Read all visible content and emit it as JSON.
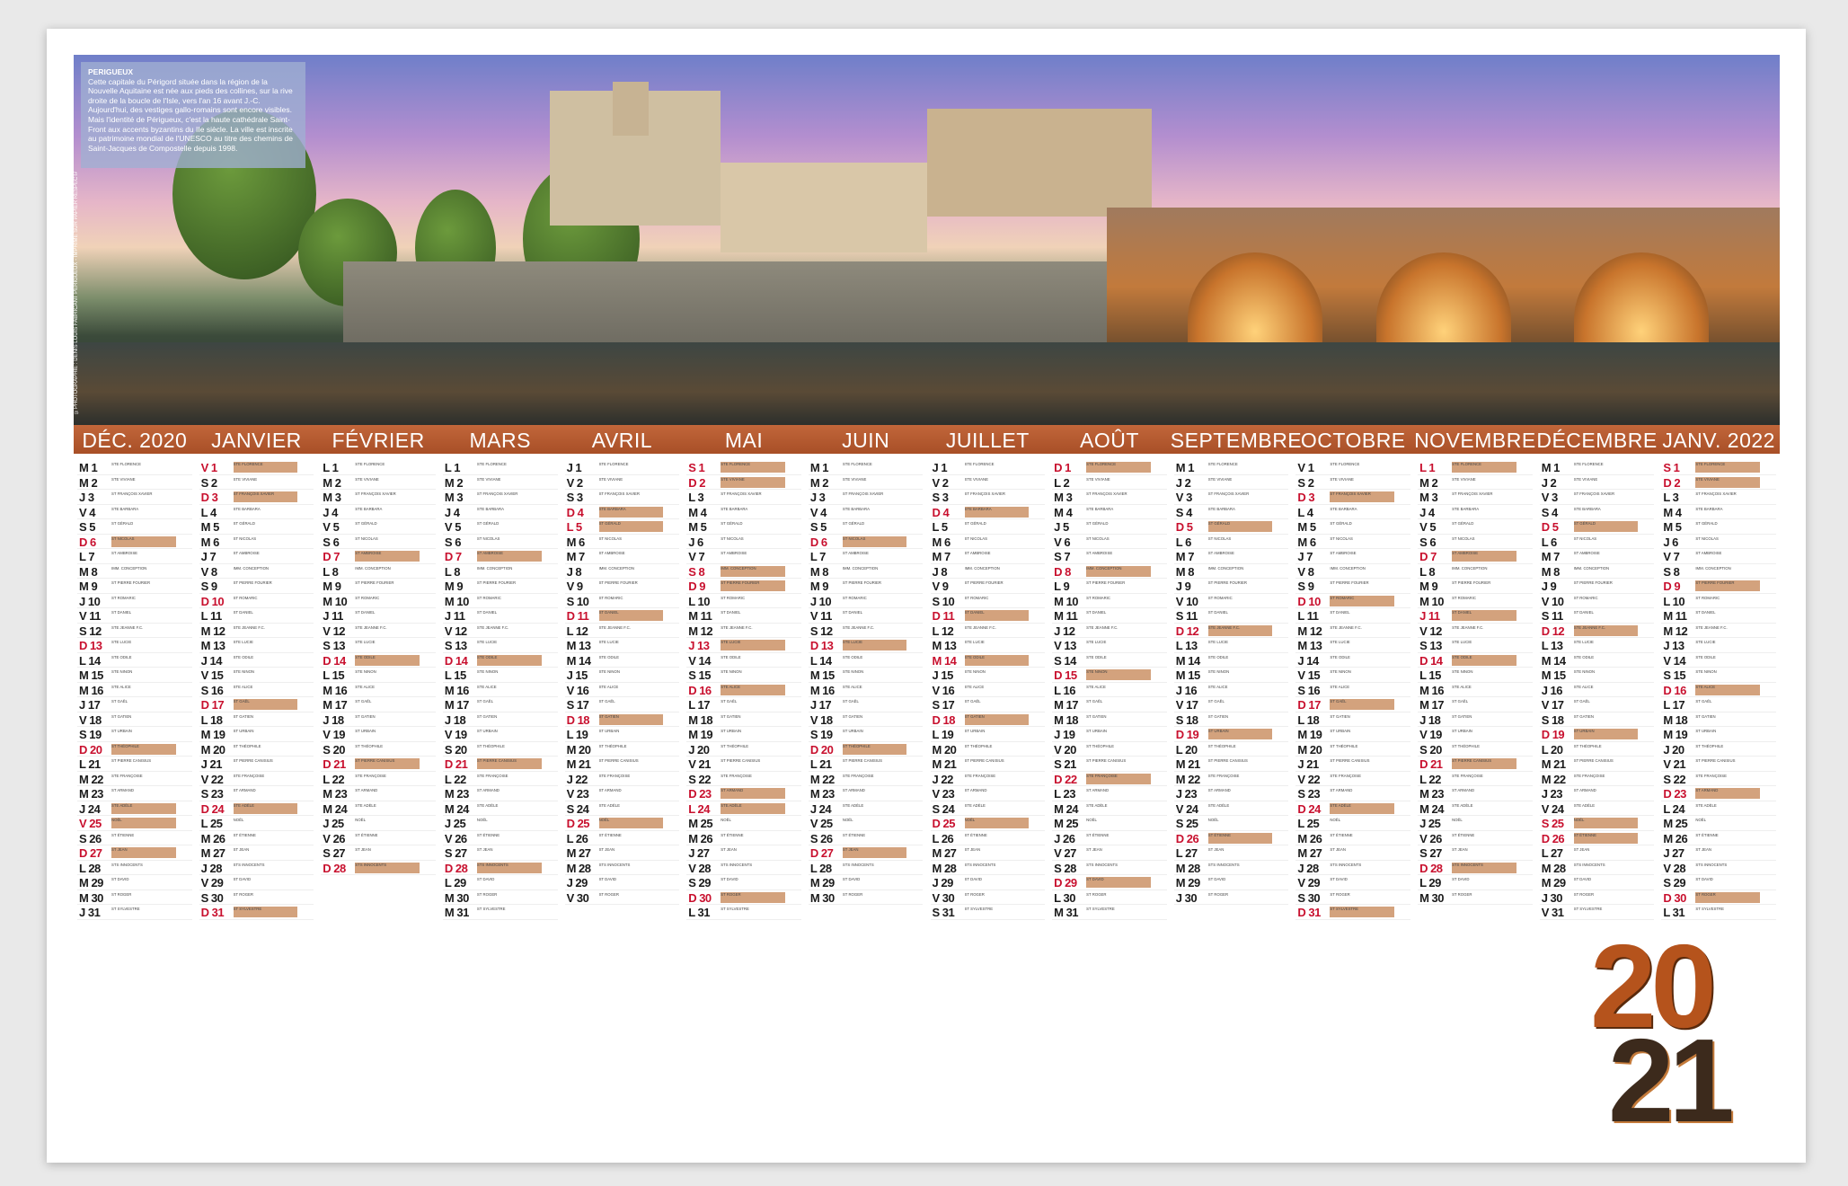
{
  "caption": {
    "title": "PERIGUEUX",
    "text": "Cette capitale du Périgord située dans la région de la Nouvelle Aquitaine est née aux pieds des collines, sur la rive droite de la boucle de l'Isle, vers l'an 16 avant J.-C. Aujourd'hui, des vestiges gallo-romains sont encore visibles. Mais l'identité de Périgueux, c'est la haute cathédrale Saint-Front aux accents byzantins du IIe siècle. La ville est inscrite au patrimoine mondial de l'UNESCO au titre des chemins de Saint-Jacques de Compostelle depuis 1998."
  },
  "credit": "©PHOTOGRAPHIE : DENIS LOUIS FABRICANT PERIGUEUX - IMPRIMÉ SUR PAPIER RESPECTANT LA GESTION DURABLE DE LA FORÊT",
  "months": [
    {
      "label": "DÉC. 2020",
      "start": 1,
      "days": 31,
      "red": [
        6,
        13,
        20,
        25,
        27
      ],
      "hl": [
        6,
        20,
        24,
        25,
        27
      ]
    },
    {
      "label": "JANVIER",
      "start": 4,
      "days": 31,
      "red": [
        1,
        3,
        10,
        17,
        24,
        31
      ],
      "hl": [
        1,
        3,
        17,
        24,
        31
      ]
    },
    {
      "label": "FÉVRIER",
      "start": 0,
      "days": 28,
      "red": [
        7,
        14,
        21,
        28
      ],
      "hl": [
        7,
        14,
        21,
        28
      ]
    },
    {
      "label": "MARS",
      "start": 0,
      "days": 31,
      "red": [
        7,
        14,
        21,
        28
      ],
      "hl": [
        7,
        14,
        21,
        28
      ]
    },
    {
      "label": "AVRIL",
      "start": 3,
      "days": 30,
      "red": [
        4,
        5,
        11,
        18,
        25
      ],
      "hl": [
        4,
        5,
        11,
        18,
        25
      ]
    },
    {
      "label": "MAI",
      "start": 5,
      "days": 31,
      "red": [
        1,
        2,
        8,
        9,
        13,
        16,
        23,
        24,
        30
      ],
      "hl": [
        1,
        2,
        8,
        9,
        13,
        16,
        23,
        24,
        30
      ]
    },
    {
      "label": "JUIN",
      "start": 1,
      "days": 30,
      "red": [
        6,
        13,
        20,
        27
      ],
      "hl": [
        6,
        13,
        20,
        27
      ]
    },
    {
      "label": "JUILLET",
      "start": 3,
      "days": 31,
      "red": [
        4,
        11,
        14,
        18,
        25
      ],
      "hl": [
        4,
        11,
        14,
        18,
        25
      ]
    },
    {
      "label": "AOÛT",
      "start": 6,
      "days": 31,
      "red": [
        1,
        8,
        15,
        22,
        29
      ],
      "hl": [
        1,
        8,
        15,
        22,
        29
      ]
    },
    {
      "label": "SEPTEMBRE",
      "start": 2,
      "days": 30,
      "red": [
        5,
        12,
        19,
        26
      ],
      "hl": [
        5,
        12,
        19,
        26
      ]
    },
    {
      "label": "OCTOBRE",
      "start": 4,
      "days": 31,
      "red": [
        3,
        10,
        17,
        24,
        31
      ],
      "hl": [
        3,
        10,
        17,
        24,
        31
      ]
    },
    {
      "label": "NOVEMBRE",
      "start": 0,
      "days": 30,
      "red": [
        1,
        7,
        11,
        14,
        21,
        28
      ],
      "hl": [
        1,
        7,
        11,
        14,
        21,
        28
      ]
    },
    {
      "label": "DÉCEMBRE",
      "start": 2,
      "days": 31,
      "red": [
        5,
        12,
        19,
        25,
        26
      ],
      "hl": [
        5,
        12,
        19,
        25,
        26
      ]
    },
    {
      "label": "JANV. 2022",
      "start": 5,
      "days": 31,
      "red": [
        1,
        2,
        9,
        16,
        23,
        30
      ],
      "hl": [
        1,
        2,
        9,
        16,
        23,
        30
      ]
    }
  ],
  "dayLetters": [
    "L",
    "M",
    "M",
    "J",
    "V",
    "S",
    "D"
  ],
  "saints": [
    "STE FLORENCE",
    "STE VIVIANE",
    "ST FRANÇOIS XAVIER",
    "STE BARBARA",
    "ST GÉRALD",
    "ST NICOLAS",
    "ST AMBROISE",
    "IMM. CONCEPTION",
    "ST PIERRE FOURIER",
    "ST ROMARIC",
    "ST DANIEL",
    "STE JEANNE F.C.",
    "STE LUCIE",
    "STE ODILE",
    "STE NINON",
    "STE ALICE",
    "ST GAËL",
    "ST GATIEN",
    "ST URBAIN",
    "ST THÉOPHILE",
    "ST PIERRE CANISIUS",
    "STE FRANÇOISE",
    "ST ARMAND",
    "STE ADÈLE",
    "NOËL",
    "ST ÉTIENNE",
    "ST JEAN",
    "STS INNOCENTS",
    "ST DAVID",
    "ST ROGER",
    "ST SYLVESTRE"
  ],
  "year": {
    "top": "20",
    "bottom": "21"
  }
}
